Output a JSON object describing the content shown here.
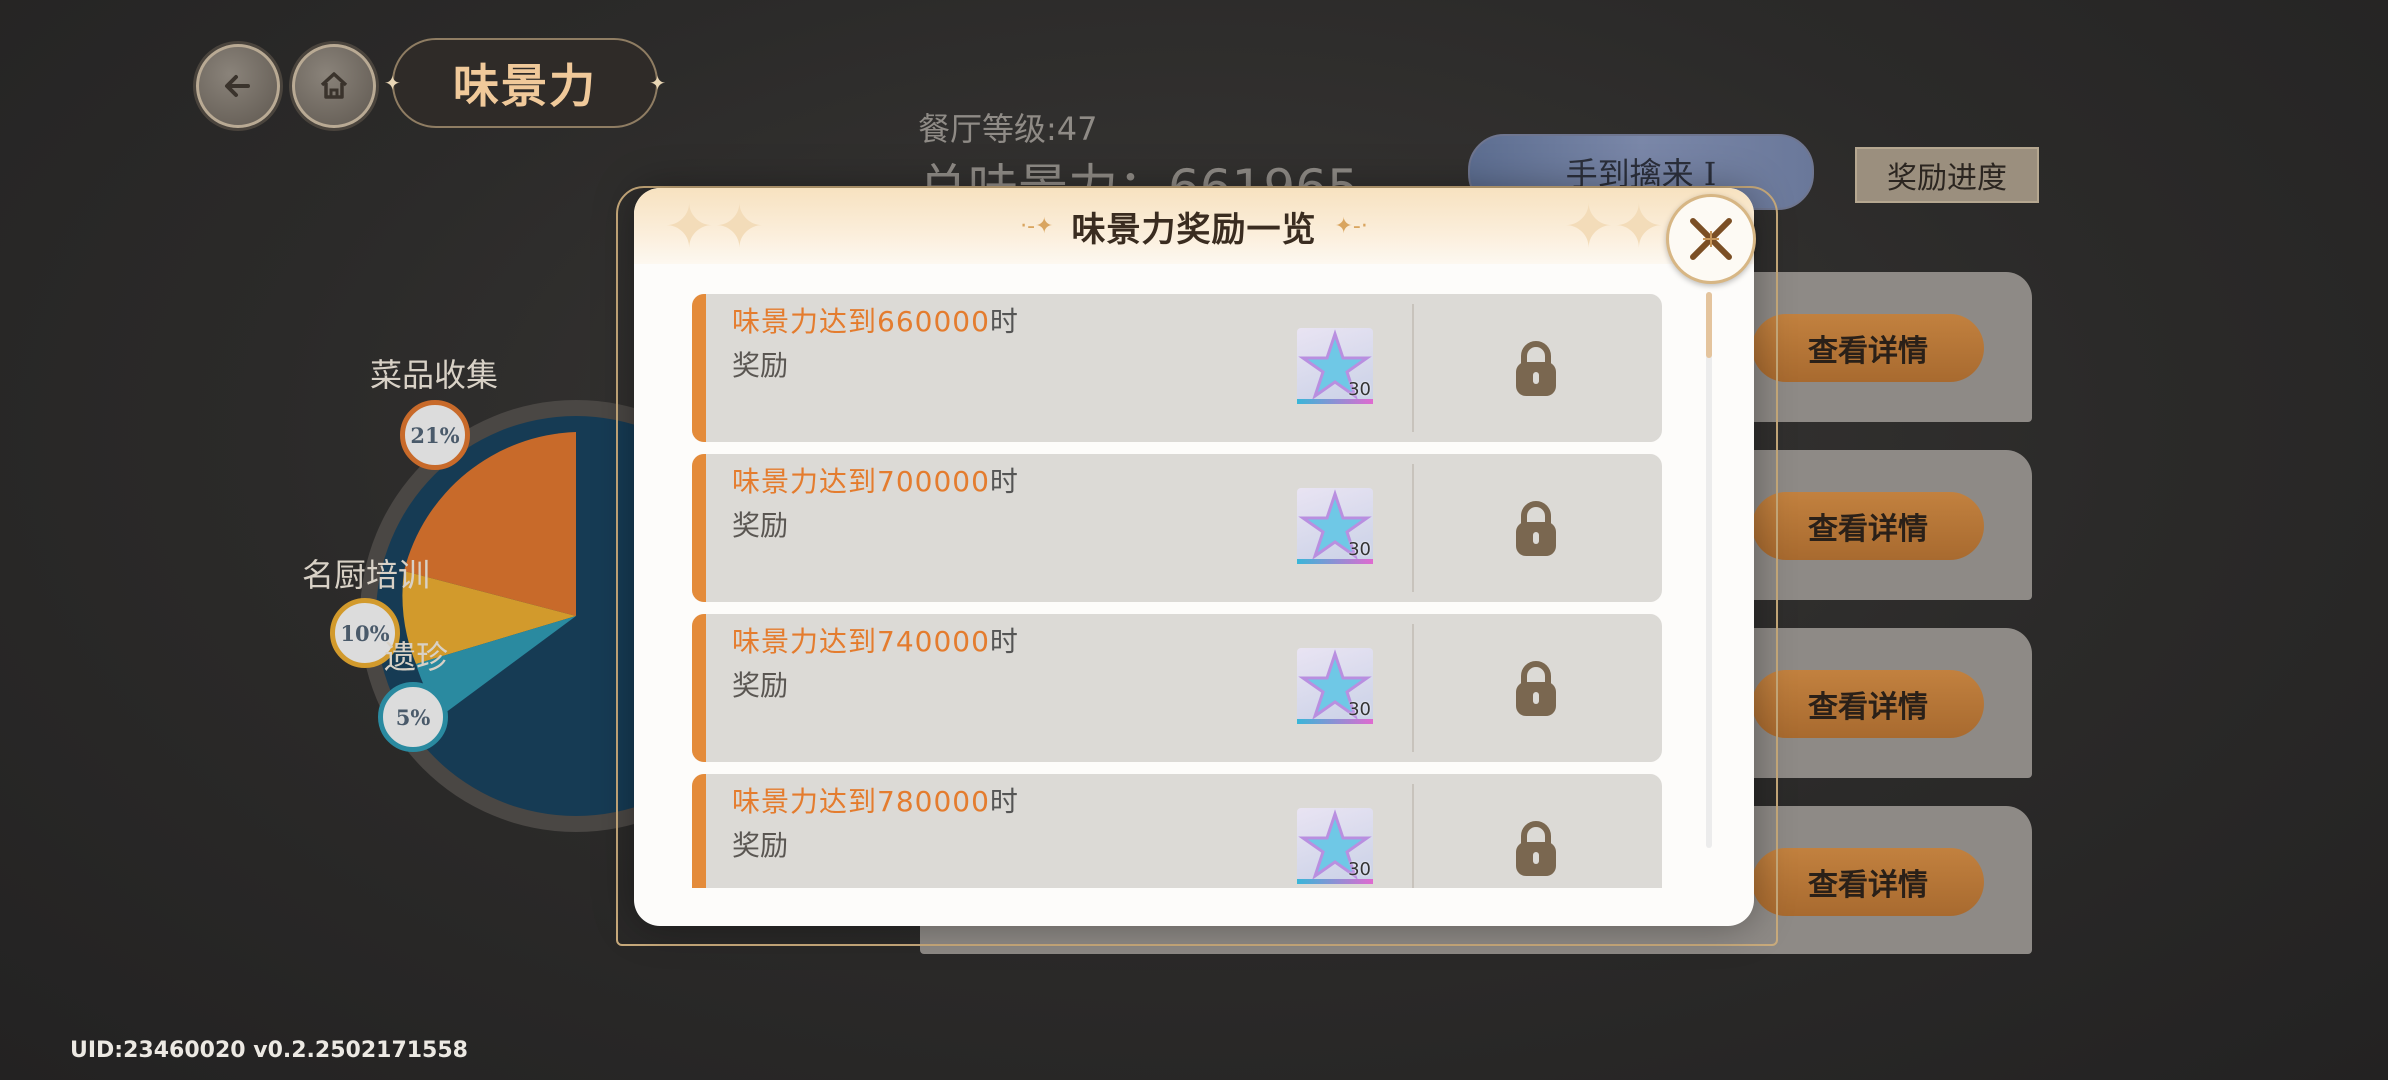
{
  "header": {
    "back_icon": "back-arrow-icon",
    "home_icon": "home-icon",
    "title": "味景力"
  },
  "stats": {
    "restaurant_level": "餐厅等级:47",
    "total_power": "总味景力：661965"
  },
  "pie": {
    "labels": [
      {
        "name": "菜品收集",
        "pct": "21%"
      },
      {
        "name": "名厨培训",
        "pct": "10%"
      },
      {
        "name": "遗珍",
        "pct": "5%"
      }
    ],
    "colors": {
      "orange": "#c86a2a",
      "yellow": "#d29a2c",
      "teal": "#2a8aa0",
      "navy": "#163b54"
    }
  },
  "hud": {
    "pill_label": "手到擒来 I",
    "progress_button": "奖励进度"
  },
  "cards": {
    "detail_label": "查看详情"
  },
  "modal": {
    "title": "味景力奖励一览",
    "close_icon": "close-x-icon",
    "rows": [
      {
        "threshold": "味景力达到660000",
        "suffix": "时",
        "sub": "奖励",
        "qty": "30",
        "status": "locked"
      },
      {
        "threshold": "味景力达到700000",
        "suffix": "时",
        "sub": "奖励",
        "qty": "30",
        "status": "locked"
      },
      {
        "threshold": "味景力达到740000",
        "suffix": "时",
        "sub": "奖励",
        "qty": "30",
        "status": "locked"
      },
      {
        "threshold": "味景力达到780000",
        "suffix": "时",
        "sub": "奖励",
        "qty": "30",
        "status": "locked"
      }
    ]
  },
  "footer": {
    "uid": "UID:23460020  v0.2.2502171558"
  },
  "theme": {
    "accent": "#e48b3a",
    "gold": "#d7b684"
  }
}
